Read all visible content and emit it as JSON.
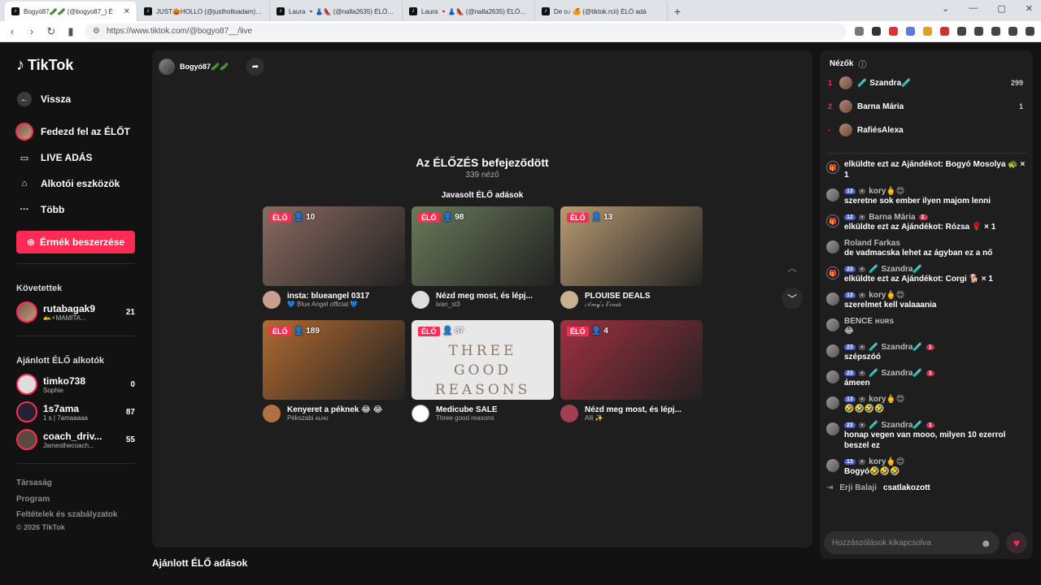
{
  "browser": {
    "tabs": [
      {
        "label": "Bogyó87🥒🥒 (@bogyo87_) É"
      },
      {
        "label": "JUST🎃HOLLO (@justholloadam) ÉL"
      },
      {
        "label": "Laura 💌👗👠 (@nalla2635) ÉLŐ adá"
      },
      {
        "label": "Laura 💌👗👠 (@nalla2635) ÉLŐ adá"
      },
      {
        "label": "De o♪ 🍊 (@tiktok.rcii) ÉLŐ adá"
      }
    ],
    "url": "https://www.tiktok.com/@bogyo87__/live"
  },
  "sidebar": {
    "logo": "TikTok",
    "nav": [
      {
        "label": "Vissza"
      },
      {
        "label": "Fedezd fel az ÉLŐT"
      },
      {
        "label": "LIVE ADÁS"
      },
      {
        "label": "Alkotói eszközök"
      },
      {
        "label": "Több"
      }
    ],
    "coins_button": "Érmék beszerzése",
    "following_title": "Követettek",
    "following": [
      {
        "name": "rutabagak9",
        "sub": "🫴⚡MAMÍTA...",
        "count": "21"
      }
    ],
    "recommended_title": "Ajánlott ÉLŐ alkotók",
    "recommended": [
      {
        "name": "timko738",
        "sub": "Sophie",
        "count": "0"
      },
      {
        "name": "1s7ama",
        "sub": "1 s | 7amaaaaa",
        "count": "87"
      },
      {
        "name": "coach_driv...",
        "sub": "Jamesthecoach...",
        "count": "55"
      }
    ],
    "footer": [
      "Társaság",
      "Program",
      "Feltételek és szabályzatok"
    ],
    "copyright": "© 2026 TikTok"
  },
  "main": {
    "host_name": "Bogyó87🥒🥒",
    "ended_title": "Az ÉLŐZÉS befejeződött",
    "ended_viewers": "339 néző",
    "suggested_title": "Javasolt ÉLŐ adások",
    "live_label": "ÉLŐ",
    "cards": [
      {
        "views": "10",
        "title": "insta: blueangel 0317",
        "sub": "💙 Blue Angel official 💙",
        "color": "#8a6a60"
      },
      {
        "views": "98",
        "title": "Nézd meg most, és lépj...",
        "sub": "ivan_st3",
        "color": "#6a7a5a"
      },
      {
        "views": "13",
        "title": "PLOUISE DEALS",
        "sub": "𝒜𝓂𝓎'𝓈 𝐹𝒾𝓃𝒹𝓈",
        "color": "#b89a70"
      },
      {
        "views": "189",
        "title": "Kenyeret a péknek 😂 😂",
        "sub": "Pékszabi ᴀʟʜᴜ",
        "color": "#b06a30"
      },
      {
        "views": "87",
        "title": "Medicube SALE",
        "sub": "Three good reasons",
        "color": "#e8e8e8",
        "thumb_text": "THREE GOOD REASONS"
      },
      {
        "views": "4",
        "title": "Nézd meg most, és lépj...",
        "sub": "Alli ✨",
        "color": "#a03040"
      }
    ],
    "recommended_title": "Ajánlott ÉLŐ adások"
  },
  "chat": {
    "viewers_title": "Nézők",
    "viewers": [
      {
        "rank": "1",
        "name": "🧪 Szandra🧪",
        "count": "299"
      },
      {
        "rank": "2",
        "name": "Barna Mária",
        "count": "1"
      },
      {
        "rank": "-",
        "name": "RafiésAlexa",
        "count": ""
      }
    ],
    "messages": [
      {
        "kind": "gift",
        "user": "",
        "text": "elküldte ezt az Ajándékot: Bogyó Mosolya 🐢 × 1"
      },
      {
        "kind": "msg",
        "level": "13",
        "user": "kory🖕😊",
        "text": "szeretne sok ember ilyen majom lenni"
      },
      {
        "kind": "gift",
        "level": "12",
        "user": "Barna Mária",
        "rank": "2.",
        "text": "elküldte ezt az Ajándékot: Rózsa 🌹 × 1"
      },
      {
        "kind": "msg",
        "user": "Roland Farkas",
        "text": "de vadmacska lehet az ágyban ez a nő"
      },
      {
        "kind": "gift",
        "level": "23",
        "user": "🧪 Szandra🧪",
        "text": "elküldte ezt az Ajándékot: Corgi 🐕 × 1"
      },
      {
        "kind": "msg",
        "level": "13",
        "user": "kory🖕😊",
        "text": "szerelmet kell valaaania"
      },
      {
        "kind": "msg",
        "user": "BENCE ʜᴜʀs",
        "text": "😂"
      },
      {
        "kind": "msg",
        "level": "23",
        "user": "🧪 Szandra🧪",
        "rank": "1",
        "text": "szépszóó"
      },
      {
        "kind": "msg",
        "level": "23",
        "user": "🧪 Szandra🧪",
        "rank": "1",
        "text": "ámeen"
      },
      {
        "kind": "msg",
        "level": "13",
        "user": "kory🖕😊",
        "text": "🤣🤣🤣🤣"
      },
      {
        "kind": "msg",
        "level": "23",
        "user": "🧪 Szandra🧪",
        "rank": "1",
        "text": "honap vegen van mooo, milyen 10 ezerrol beszel ez"
      },
      {
        "kind": "msg",
        "level": "13",
        "user": "kory🖕😊",
        "text": "Bogyó🤣🤣🤣"
      }
    ],
    "join": {
      "user": "Erji Balaji",
      "action": "csatlakozott"
    },
    "input_placeholder": "Hozzászólások kikapcsolva"
  }
}
